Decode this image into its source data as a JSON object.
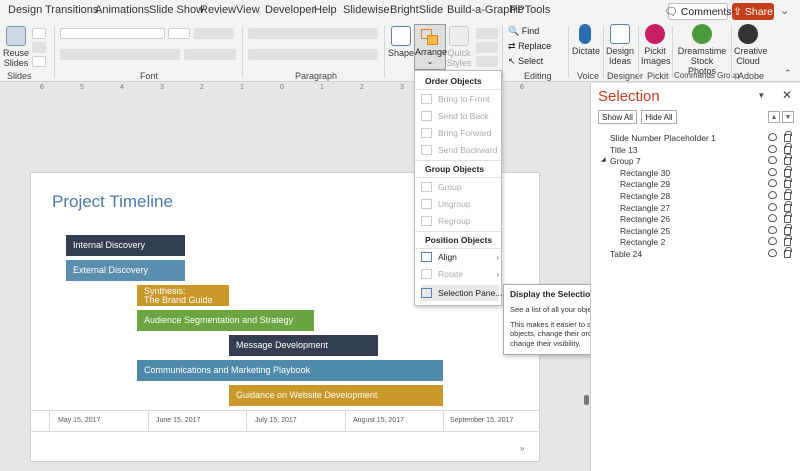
{
  "tabs": [
    "Design",
    "Transitions",
    "Animations",
    "Slide Show",
    "Review",
    "View",
    "Developer",
    "Help",
    "Slidewise",
    "BrightSlide",
    "Build-a-Graphic",
    "PPTools"
  ],
  "header": {
    "comments": "Comments",
    "share": "Share",
    "more": "⌄"
  },
  "ribbon": {
    "reuse_slides": "Reuse Slides",
    "group_slides": "Slides",
    "group_font": "Font",
    "group_paragraph": "Paragraph",
    "shapes": "Shapes",
    "arrange": "Arrange",
    "quick_styles": "Quick Styles",
    "find": "Find",
    "replace": "Replace",
    "select": "Select",
    "group_editing": "Editing",
    "dictate": "Dictate",
    "group_voice": "Voice",
    "design_ideas": "Design Ideas",
    "group_designer": "Designer",
    "pickit": "Pickit Images",
    "group_pickit": "Pickit",
    "dreamstime": "Dreamstime Stock Photos",
    "group_commands": "Commands Group",
    "creative_cloud": "Creative Cloud",
    "group_adobe": "Adobe"
  },
  "ruler_ticks": [
    "6",
    "5",
    "4",
    "3",
    "2",
    "1",
    "0",
    "1",
    "2",
    "3",
    "4",
    "5",
    "6"
  ],
  "slide": {
    "title": "Project Timeline",
    "bars": [
      {
        "label": "Internal Discovery",
        "color": "#333f50"
      },
      {
        "label": "External Discovery",
        "color": "#5b8fb0"
      },
      {
        "label": "Synthesis:\nThe Brand Guide",
        "color": "#c9972a"
      },
      {
        "label": "Audience Segmentation and Strategy",
        "color": "#6aa542"
      },
      {
        "label": "Message Development",
        "color": "#333f50"
      },
      {
        "label": "Communications and Marketing Playbook",
        "color": "#4e8aaa"
      },
      {
        "label": "Guidance on Website Development",
        "color": "#c9972a"
      }
    ],
    "dates": [
      "May 15, 2017",
      "June 15, 2017",
      "July 15, 2017",
      "August 15, 2017",
      "September 15, 2017"
    ],
    "arrow": "»"
  },
  "arrange_menu": {
    "order_header": "Order Objects",
    "bring_to_front": "Bring to Front",
    "send_to_back": "Send to Back",
    "bring_forward": "Bring Forward",
    "send_backward": "Send Backward",
    "group_header": "Group Objects",
    "group": "Group",
    "ungroup": "Ungroup",
    "regroup": "Regroup",
    "position_header": "Position Objects",
    "align": "Align",
    "rotate": "Rotate",
    "selection_pane": "Selection Pane..."
  },
  "tooltip": {
    "title": "Display the Selection Pane",
    "line1": "See a list of all your objects.",
    "line2": "This makes it easier to select objects, change their order, or change their visibility."
  },
  "selection_pane": {
    "title": "Selection",
    "show_all": "Show All",
    "hide_all": "Hide All",
    "items": [
      {
        "name": "Slide Number Placeholder 1",
        "indent": 1
      },
      {
        "name": "Title 13",
        "indent": 1
      },
      {
        "name": "Group 7",
        "indent": 1,
        "group": true
      },
      {
        "name": "Rectangle 30",
        "indent": 2
      },
      {
        "name": "Rectangle 29",
        "indent": 2
      },
      {
        "name": "Rectangle 28",
        "indent": 2
      },
      {
        "name": "Rectangle 27",
        "indent": 2
      },
      {
        "name": "Rectangle 26",
        "indent": 2
      },
      {
        "name": "Rectangle 25",
        "indent": 2
      },
      {
        "name": "Rectangle 2",
        "indent": 2
      },
      {
        "name": "Table 24",
        "indent": 1
      }
    ]
  }
}
